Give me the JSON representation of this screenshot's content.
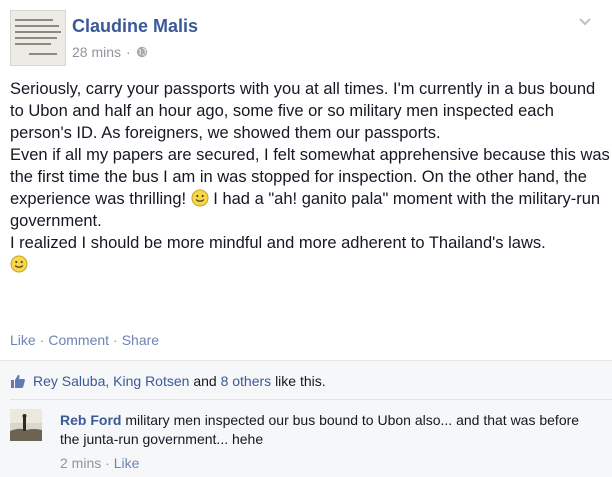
{
  "post": {
    "author": "Claudine Malis",
    "timestamp": "28 mins",
    "privacy_icon": "globe-icon",
    "paragraphs": [
      "Seriously, carry your passports with you at all times. I'm currently in a bus bound to Ubon and half an hour ago, some five or so military men inspected each person's ID. As foreigners, we showed them our passports.",
      "Even if all my papers are secured, I felt somewhat apprehensive because this was the first time the bus I am in was stopped for inspection. On the other hand, the experience was thrilling!",
      "I had a \"ah! ganito pala\" moment with the military-run government.",
      "I realized I should be more mindful and more adherent to Thailand's laws."
    ]
  },
  "actions": {
    "like": "Like",
    "comment": "Comment",
    "share": "Share",
    "separator": "·"
  },
  "likes": {
    "names": "Rey Saluba, King Rotsen",
    "and": "and",
    "others": "8 others",
    "suffix": "like this."
  },
  "comment": {
    "author": "Reb Ford",
    "text": "military men inspected our bus bound to Ubon also... and that was before the junta-run government... hehe",
    "timestamp": "2 mins",
    "like": "Like",
    "separator": "·"
  },
  "colors": {
    "link": "#3b5998",
    "muted": "#90949c",
    "feedback_bg": "#f6f7f9"
  }
}
